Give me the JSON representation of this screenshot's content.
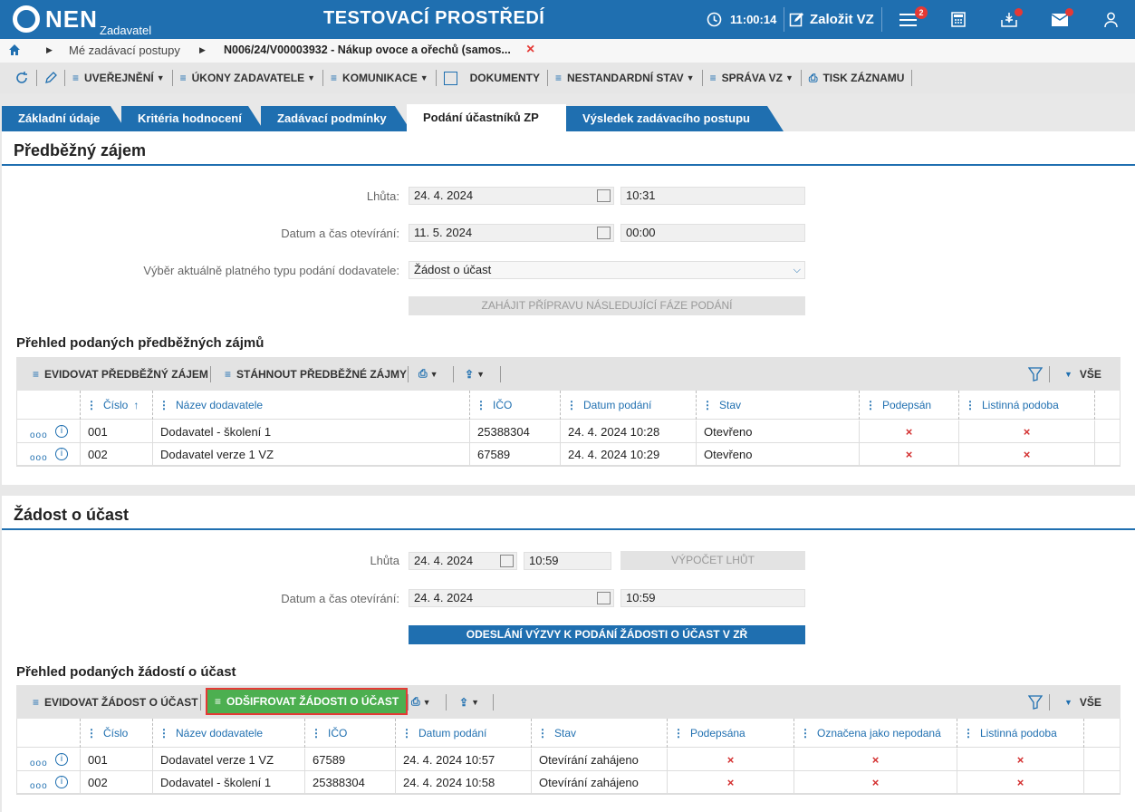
{
  "topbar": {
    "logo": "NEN",
    "logo_sub": "Zadavatel",
    "environment": "TESTOVACÍ PROSTŘEDÍ",
    "timer": "11:00:14",
    "create_label": "Založit VZ",
    "menu_badge": "2"
  },
  "breadcrumb": {
    "item1": "Mé zadávací postupy",
    "item2": "N006/24/V00003932 - Nákup ovoce a ořechů (samos..."
  },
  "toolbar": {
    "publish": "UVEŘEJNĚNÍ",
    "actions": "ÚKONY ZADAVATELE",
    "communication": "KOMUNIKACE",
    "documents": "DOKUMENTY",
    "nonstandard": "NESTANDARDNÍ STAV",
    "management": "SPRÁVA VZ",
    "print": "TISK ZÁZNAMU"
  },
  "tabs": [
    "Základní údaje",
    "Kritéria hodnocení",
    "Zadávací podmínky",
    "Podání účastníků ZP",
    "Výsledek zadávacího postupu"
  ],
  "s1": {
    "title": "Předběžný zájem",
    "deadline_label": "Lhůta:",
    "deadline_date": "24. 4. 2024",
    "deadline_time": "10:31",
    "open_label": "Datum a čas otevírání:",
    "open_date": "11. 5. 2024",
    "open_time": "00:00",
    "type_label": "Výběr aktuálně platného typu podání dodavatele:",
    "type_value": "Žádost o účast",
    "next_phase": "ZAHÁJIT PŘÍPRAVU NÁSLEDUJÍCÍ FÁZE PODÁNÍ",
    "overview": "Přehled podaných předběžných zájmů",
    "btn_register": "EVIDOVAT PŘEDBĚŽNÝ ZÁJEM",
    "btn_download": "STÁHNOUT PŘEDBĚŽNÉ ZÁJMY",
    "all": "VŠE",
    "columns": [
      "Číslo",
      "Název dodavatele",
      "IČO",
      "Datum podání",
      "Stav",
      "Podepsán",
      "Listinná podoba"
    ],
    "rows": [
      [
        "001",
        "Dodavatel - školení 1",
        "25388304",
        "24. 4. 2024 10:28",
        "Otevřeno"
      ],
      [
        "002",
        "Dodavatel verze 1 VZ",
        "67589",
        "24. 4. 2024 10:29",
        "Otevřeno"
      ]
    ]
  },
  "s2": {
    "title": "Žádost o účast",
    "deadline_label": "Lhůta",
    "deadline_date": "24. 4. 2024",
    "deadline_time": "10:59",
    "calc": "VÝPOČET LHŮT",
    "open_label": "Datum a čas otevírání:",
    "open_date": "24. 4. 2024",
    "open_time": "10:59",
    "send": "ODESLÁNÍ VÝZVY K PODÁNÍ ŽÁDOSTI O ÚČAST V ZŘ",
    "overview": "Přehled podaných žádostí o účast",
    "btn_register": "EVIDOVAT ŽÁDOST O ÚČAST",
    "btn_decrypt": "ODŠIFROVAT ŽÁDOSTI O ÚČAST",
    "all": "VŠE",
    "columns": [
      "Číslo",
      "Název dodavatele",
      "IČO",
      "Datum podání",
      "Stav",
      "Podepsána",
      "Označena jako nepodaná",
      "Listinná podoba"
    ],
    "rows": [
      [
        "001",
        "Dodavatel verze 1 VZ",
        "67589",
        "24. 4. 2024 10:57",
        "Otevírání zahájeno"
      ],
      [
        "002",
        "Dodavatel - školení 1",
        "25388304",
        "24. 4. 2024 10:58",
        "Otevírání zahájeno"
      ]
    ]
  },
  "x_mark": "×"
}
